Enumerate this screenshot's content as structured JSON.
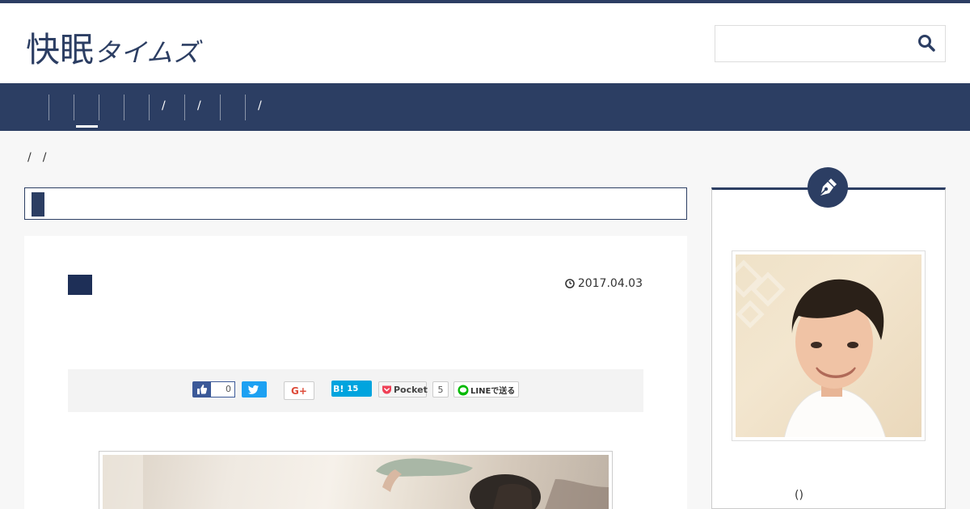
{
  "header": {
    "logo_kanji": "快眠",
    "logo_kana": "タイムズ",
    "search_placeholder": ""
  },
  "nav": {
    "separators": [
      "/",
      "/",
      "/"
    ]
  },
  "breadcrumb": {
    "separators": [
      "/",
      "/"
    ]
  },
  "article": {
    "date": "2017.04.03"
  },
  "share": {
    "facebook_count": "0",
    "gplus_label": "G+",
    "hatena_label": "B!",
    "hatena_count": "15",
    "pocket_label": "Pocket",
    "pocket_count": "5",
    "line_label": "LINEで送る"
  },
  "sidebar": {
    "author_caption": "()"
  },
  "colors": {
    "brand": "#2c3e63",
    "facebook": "#3b5998",
    "twitter": "#1da1f2",
    "hatena": "#00a4de",
    "line": "#00b900",
    "pocket": "#ef4056"
  }
}
